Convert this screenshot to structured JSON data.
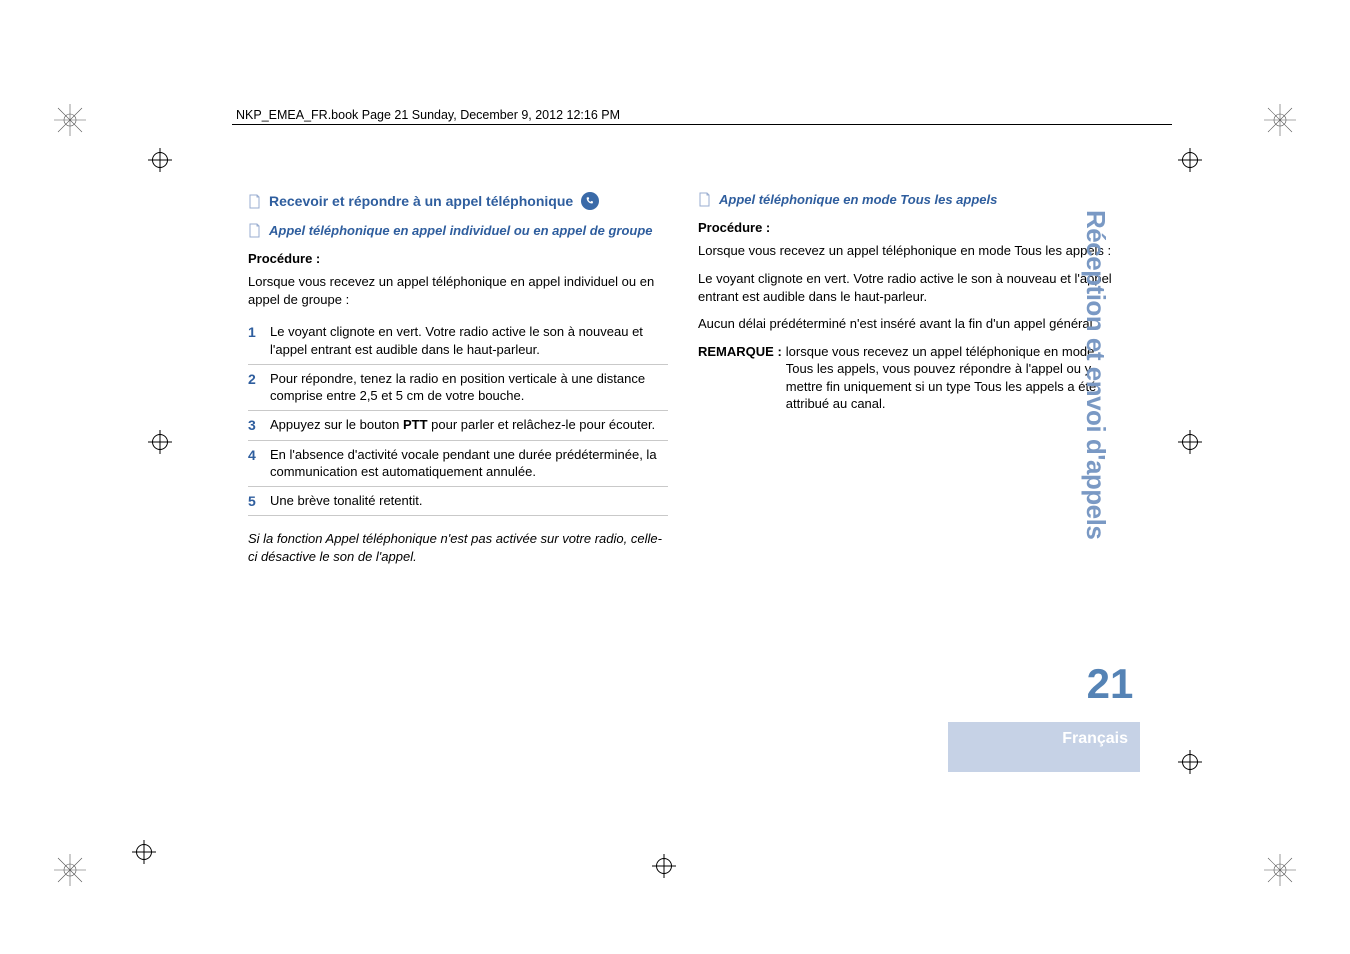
{
  "header": "NKP_EMEA_FR.book  Page 21  Sunday, December 9, 2012  12:16 PM",
  "section_title": "Recevoir et répondre à un appel téléphonique",
  "left": {
    "subheading": "Appel téléphonique en appel individuel ou en appel de groupe",
    "procedure_label": "Procédure :",
    "intro": "Lorsque vous recevez un appel téléphonique en appel individuel ou en appel de groupe :",
    "steps": {
      "1": {
        "num": "1",
        "text": "Le voyant clignote en vert. Votre radio active le son à nouveau et l'appel entrant est audible dans le haut-parleur."
      },
      "2": {
        "num": "2",
        "text": "Pour répondre, tenez la radio en position verticale à une distance comprise entre 2,5 et 5 cm de votre bouche."
      },
      "3": {
        "num": "3",
        "prefix": "Appuyez sur le bouton ",
        "bold": "PTT",
        "suffix": " pour parler et relâchez-le pour écouter."
      },
      "4": {
        "num": "4",
        "text": "En l'absence d'activité vocale pendant une durée prédéterminée, la communication est automatiquement annulée."
      },
      "5": {
        "num": "5",
        "text": "Une brève tonalité retentit."
      }
    },
    "footnote": "Si la fonction Appel téléphonique n'est pas activée sur votre radio, celle-ci désactive le son de l'appel."
  },
  "right": {
    "subheading": "Appel téléphonique en mode Tous les appels",
    "procedure_label": "Procédure :",
    "intro": "Lorsque vous recevez un appel téléphonique en mode Tous les appels :",
    "para1": "Le voyant clignote en vert. Votre radio active le son à nouveau et l'appel entrant est audible dans le haut-parleur.",
    "para2": "Aucun délai prédéterminé n'est inséré avant la fin d'un appel général.",
    "remark_label": "REMARQUE :",
    "remark_body": "lorsque vous recevez un appel téléphonique en mode Tous les appels, vous pouvez répondre à l'appel ou y mettre fin uniquement si un type Tous les appels a été attribué au canal."
  },
  "tab": {
    "side_label": "Réception et envoi d'appels",
    "page_number": "21",
    "language": "Français"
  }
}
